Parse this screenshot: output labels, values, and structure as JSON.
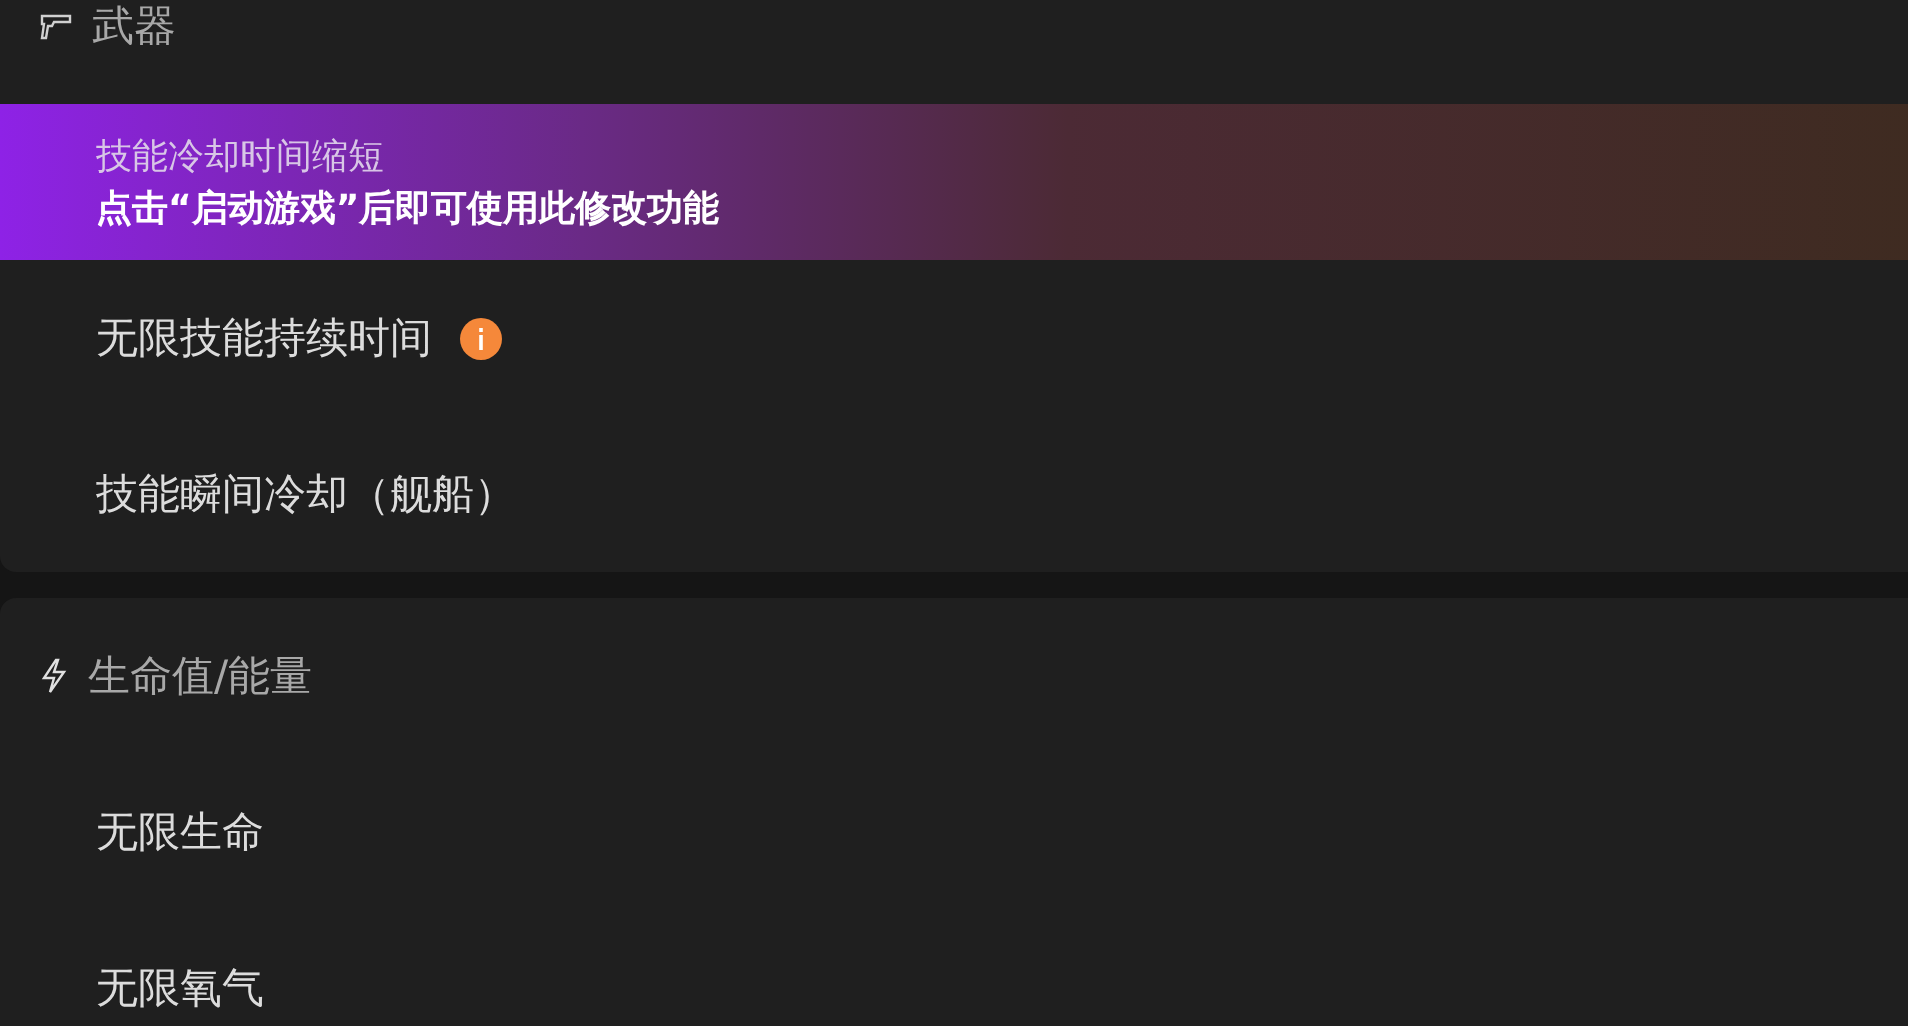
{
  "sections": [
    {
      "title": "武器",
      "kind": "weapon",
      "items": [
        {
          "label": "技能冷却时间缩短",
          "selected": true,
          "hint": "点击“启动游戏”后即可使用此修改功能",
          "info": false
        },
        {
          "label": "无限技能持续时间",
          "selected": false,
          "info": true
        },
        {
          "label": "技能瞬间冷却（舰船）",
          "selected": false,
          "info": false
        }
      ]
    },
    {
      "title": "生命值/能量",
      "kind": "energy",
      "items": [
        {
          "label": "无限生命",
          "selected": false,
          "info": false
        },
        {
          "label": "无限氧气",
          "selected": false,
          "info": false
        }
      ]
    }
  ]
}
